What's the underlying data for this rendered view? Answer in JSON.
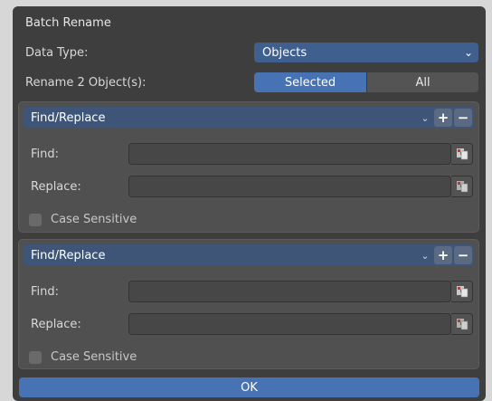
{
  "dialog": {
    "title": "Batch Rename",
    "data_type_label": "Data Type:",
    "data_type_value": "Objects",
    "rename_label": "Rename 2 Object(s):",
    "scope_options": [
      "Selected",
      "All"
    ],
    "scope_selected": "Selected",
    "ok_label": "OK"
  },
  "panels": [
    {
      "title": "Find/Replace",
      "find_label": "Find:",
      "find_value": "",
      "replace_label": "Replace:",
      "replace_value": "",
      "case_label": "Case Sensitive",
      "case_checked": false
    },
    {
      "title": "Find/Replace",
      "find_label": "Find:",
      "find_value": "",
      "replace_label": "Replace:",
      "replace_value": "",
      "case_label": "Case Sensitive",
      "case_checked": false
    }
  ],
  "icons": {
    "dropdown": "chevron-down-icon",
    "add": "plus-icon",
    "remove": "minus-icon",
    "field_picker": "eyedropper-icon"
  },
  "colors": {
    "accent": "#4772b3",
    "panel_header": "#3e5577",
    "dialog_bg": "#3e3e3e",
    "panel_bg": "#505050"
  }
}
